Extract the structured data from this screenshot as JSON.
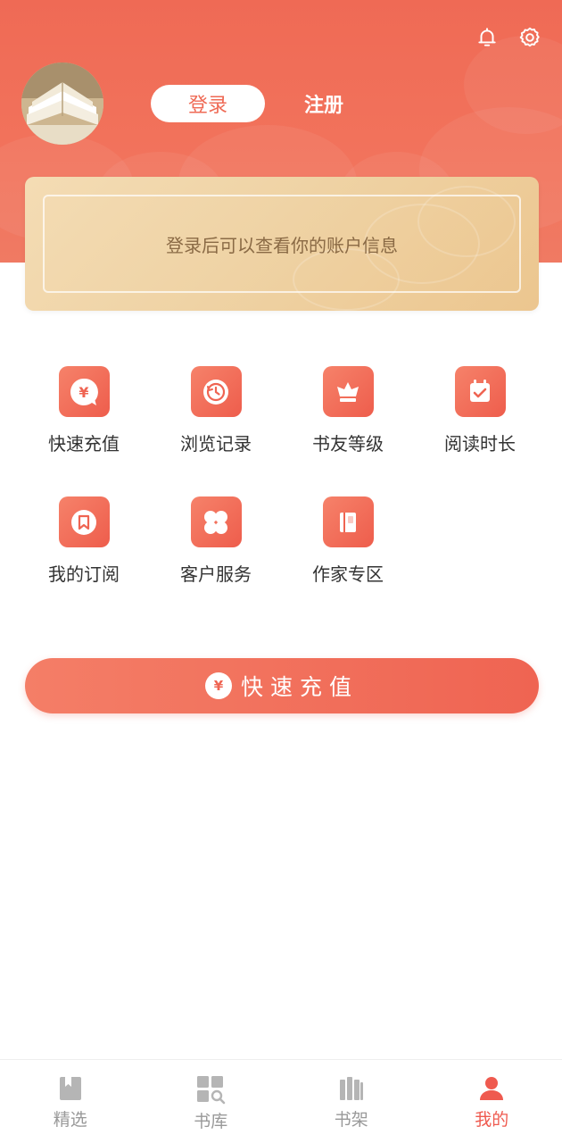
{
  "colors": {
    "accent": "#ef6a55",
    "active_tab": "#ef5a4f",
    "inactive_tab": "#999999",
    "card_text": "#8a6a45"
  },
  "header": {
    "icons": [
      "bell-icon",
      "gear-icon"
    ],
    "login_label": "登录",
    "register_label": "注册"
  },
  "account_card": {
    "message": "登录后可以查看你的账户信息"
  },
  "features": [
    {
      "label": "快速充值",
      "icon": "yuan-coin-icon"
    },
    {
      "label": "浏览记录",
      "icon": "history-clock-icon"
    },
    {
      "label": "书友等级",
      "icon": "crown-icon"
    },
    {
      "label": "阅读时长",
      "icon": "calendar-check-icon"
    },
    {
      "label": "我的订阅",
      "icon": "bookmark-icon"
    },
    {
      "label": "客户服务",
      "icon": "clover-icon"
    },
    {
      "label": "作家专区",
      "icon": "notebook-icon"
    }
  ],
  "recharge_button": {
    "coin_symbol": "¥",
    "label": "快速充值"
  },
  "tabbar": {
    "tabs": [
      {
        "label": "精选",
        "icon": "featured-book-icon",
        "active": false
      },
      {
        "label": "书库",
        "icon": "library-search-icon",
        "active": false
      },
      {
        "label": "书架",
        "icon": "bookshelf-icon",
        "active": false
      },
      {
        "label": "我的",
        "icon": "user-icon",
        "active": true
      }
    ]
  }
}
